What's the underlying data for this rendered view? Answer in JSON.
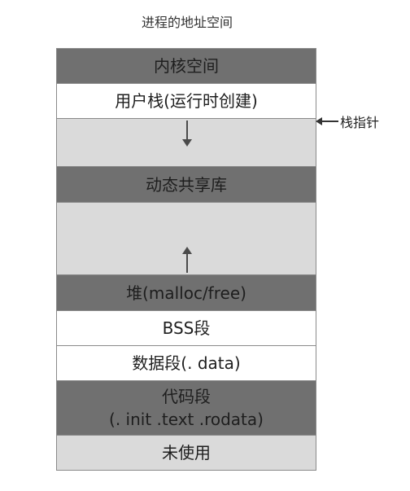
{
  "title": "进程的地址空间",
  "segments": [
    {
      "label": "内核空间",
      "tone": "dark"
    },
    {
      "label": "用户栈(运行时创建)",
      "tone": "white"
    },
    {
      "label": "",
      "tone": "light"
    },
    {
      "label": "动态共享库",
      "tone": "dark"
    },
    {
      "label": "",
      "tone": "light"
    },
    {
      "label": "堆(malloc/free)",
      "tone": "dark"
    },
    {
      "label": "BSS段",
      "tone": "white"
    },
    {
      "label": "数据段(. data)",
      "tone": "white"
    },
    {
      "label": "代码段",
      "label2": "(. init .text .rodata)",
      "tone": "dark"
    },
    {
      "label": "未使用",
      "tone": "light"
    }
  ],
  "stack_pointer_label": "栈指针",
  "colors": {
    "dark": "#707070",
    "white": "#ffffff",
    "light": "#dadada",
    "border": "#8a8a8a"
  }
}
